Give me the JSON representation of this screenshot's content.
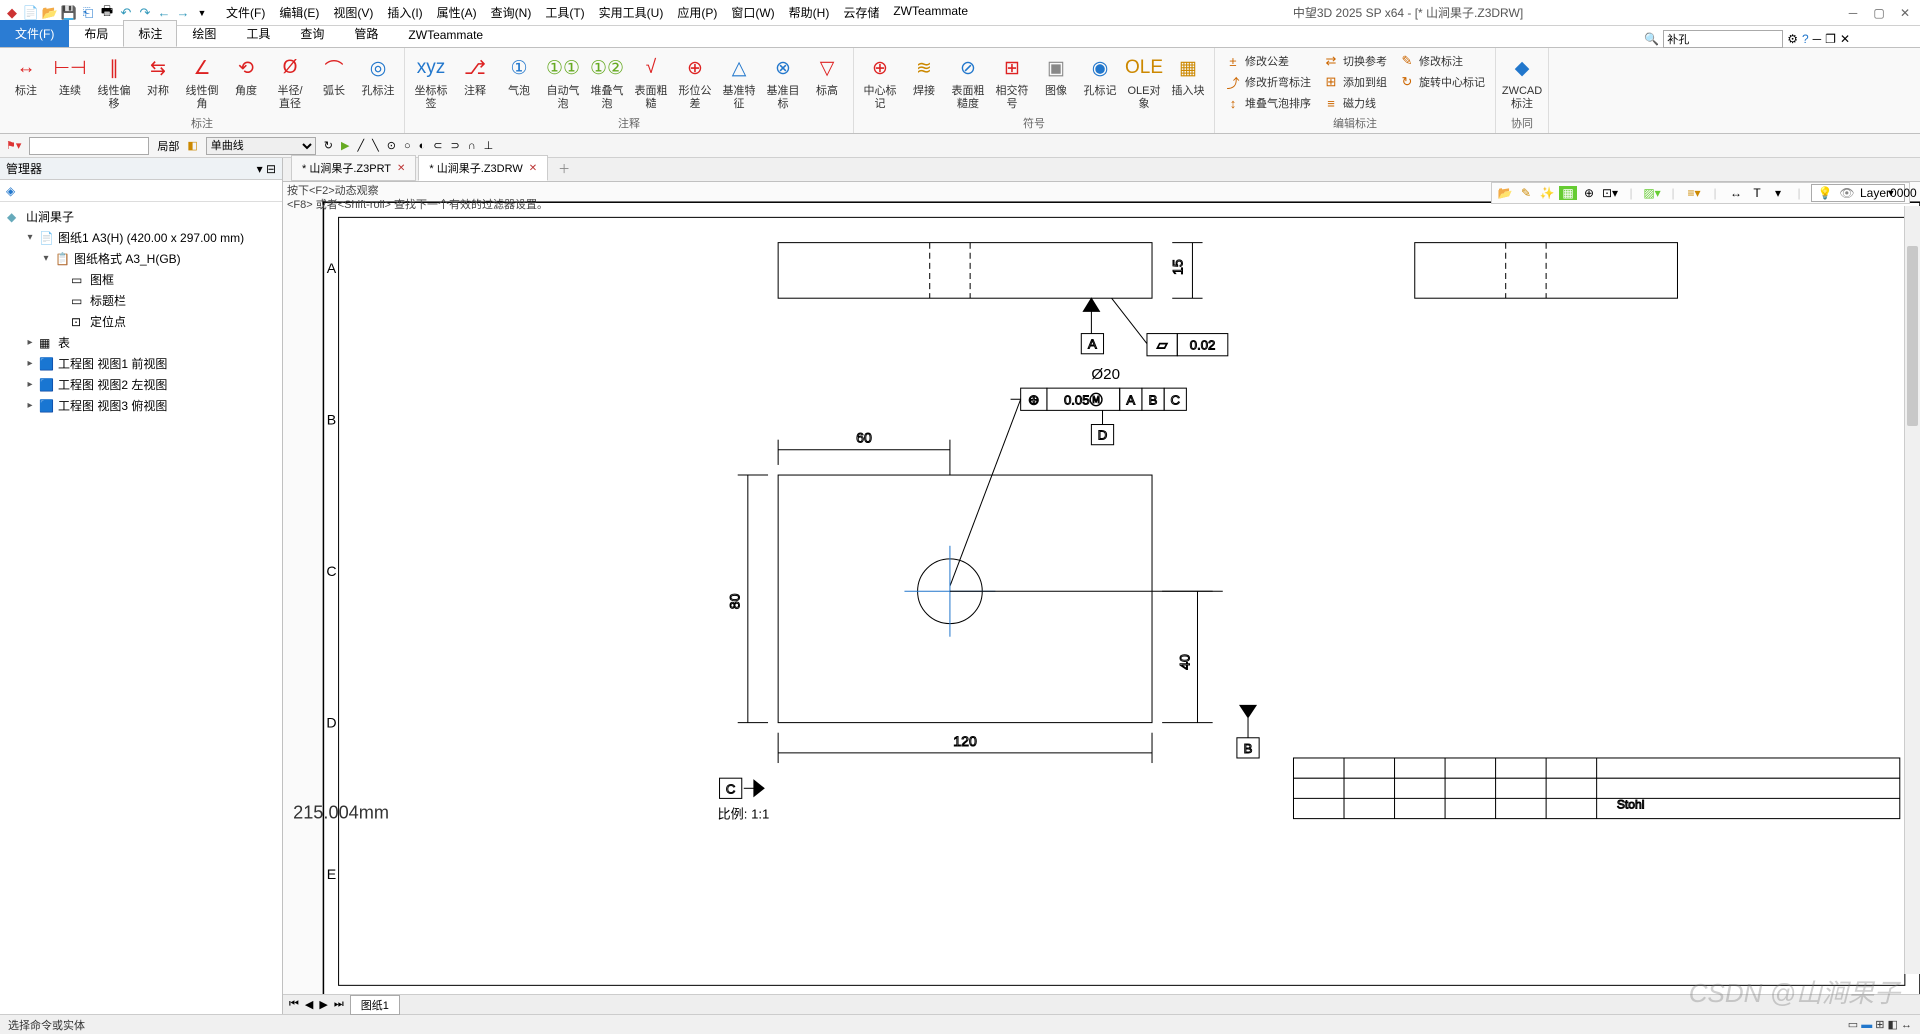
{
  "app": {
    "title": "中望3D 2025 SP x64 - [* 山涧果子.Z3DRW]"
  },
  "qat_icons": [
    "app-logo",
    "new",
    "open",
    "save",
    "saveall",
    "undo",
    "redo",
    "back",
    "fwd"
  ],
  "menus": [
    "文件(F)",
    "编辑(E)",
    "视图(V)",
    "插入(I)",
    "属性(A)",
    "查询(N)",
    "工具(T)",
    "实用工具(U)",
    "应用(P)",
    "窗口(W)",
    "帮助(H)",
    "云存储",
    "ZWTeammate"
  ],
  "tabs": {
    "file": "文件(F)",
    "items": [
      "布局",
      "标注",
      "绘图",
      "工具",
      "查询",
      "管路",
      "ZWTeammate"
    ],
    "active": "标注"
  },
  "ribbon_groups": [
    {
      "label": "标注",
      "btns": [
        {
          "n": "标注",
          "i": "↔",
          "c": "#d22"
        },
        {
          "n": "连续",
          "i": "⊢⊣",
          "c": "#d22"
        },
        {
          "n": "线性偏移",
          "i": "∥",
          "c": "#d22"
        },
        {
          "n": "对称",
          "i": "⇆",
          "c": "#d22"
        },
        {
          "n": "线性倒角",
          "i": "∠",
          "c": "#d22"
        },
        {
          "n": "角度",
          "i": "⟲",
          "c": "#d22"
        },
        {
          "n": "半径/直径",
          "i": "Ø",
          "c": "#d22"
        },
        {
          "n": "弧长",
          "i": "⌒",
          "c": "#d22"
        },
        {
          "n": "孔标注",
          "i": "◎",
          "c": "#27c"
        }
      ]
    },
    {
      "label": "注释",
      "btns": [
        {
          "n": "坐标标签",
          "i": "xyz",
          "c": "#27c"
        },
        {
          "n": "注释",
          "i": "⎇",
          "c": "#d22"
        },
        {
          "n": "气泡",
          "i": "①",
          "c": "#27c"
        },
        {
          "n": "自动气泡",
          "i": "①①",
          "c": "#6a2"
        },
        {
          "n": "堆叠气泡",
          "i": "①②",
          "c": "#6a2"
        },
        {
          "n": "表面粗糙",
          "i": "√",
          "c": "#d22"
        },
        {
          "n": "形位公差",
          "i": "⊕",
          "c": "#d22"
        },
        {
          "n": "基准特征",
          "i": "△",
          "c": "#27c"
        },
        {
          "n": "基准目标",
          "i": "⊗",
          "c": "#27c"
        },
        {
          "n": "标高",
          "i": "▽",
          "c": "#d22"
        }
      ]
    },
    {
      "label": "符号",
      "btns": [
        {
          "n": "中心标记",
          "i": "⊕",
          "c": "#d22"
        },
        {
          "n": "焊接",
          "i": "≋",
          "c": "#c80"
        },
        {
          "n": "表面粗糙度",
          "i": "⊘",
          "c": "#27c"
        },
        {
          "n": "相交符号",
          "i": "⊞",
          "c": "#d22"
        },
        {
          "n": "图像",
          "i": "▣",
          "c": "#888"
        },
        {
          "n": "孔标记",
          "i": "◉",
          "c": "#27c"
        },
        {
          "n": "OLE对象",
          "i": "OLE",
          "c": "#c80"
        },
        {
          "n": "插入块",
          "i": "▦",
          "c": "#c80"
        }
      ]
    },
    {
      "label": "编辑标注",
      "small": true,
      "btns": [
        {
          "n": "修改公差",
          "i": "±"
        },
        {
          "n": "修改折弯标注",
          "i": "⤴"
        },
        {
          "n": "堆叠气泡排序",
          "i": "↕"
        },
        {
          "n": "切换参考",
          "i": "⇄"
        },
        {
          "n": "添加到组",
          "i": "⊞"
        },
        {
          "n": "磁力线",
          "i": "≡"
        },
        {
          "n": "修改标注",
          "i": "✎"
        },
        {
          "n": "旋转中心标记",
          "i": "↻"
        }
      ]
    },
    {
      "label": "协同",
      "btns": [
        {
          "n": "ZWCAD标注",
          "i": "◆",
          "c": "#27c"
        }
      ]
    }
  ],
  "subbar": {
    "scope": "局部",
    "filter": "单曲线"
  },
  "manager": {
    "title": "管理器",
    "root": "山涧果子",
    "tree": [
      {
        "d": 1,
        "exp": "▾",
        "ico": "📄",
        "txt": "图纸1 A3(H) (420.00 x 297.00 mm)"
      },
      {
        "d": 2,
        "exp": "▾",
        "ico": "📋",
        "txt": "图纸格式 A3_H(GB)"
      },
      {
        "d": 3,
        "exp": "",
        "ico": "▭",
        "txt": "图框"
      },
      {
        "d": 3,
        "exp": "",
        "ico": "▭",
        "txt": "标题栏"
      },
      {
        "d": 3,
        "exp": "",
        "ico": "⊡",
        "txt": "定位点"
      },
      {
        "d": 1,
        "exp": "▸",
        "ico": "▦",
        "txt": "表"
      },
      {
        "d": 1,
        "exp": "▸",
        "ico": "🟦",
        "txt": "工程图 视图1 前视图"
      },
      {
        "d": 1,
        "exp": "▸",
        "ico": "🟦",
        "txt": "工程图 视图2 左视图"
      },
      {
        "d": 1,
        "exp": "▸",
        "ico": "🟦",
        "txt": "工程图 视图3 俯视图"
      }
    ]
  },
  "doctabs": [
    {
      "label": "* 山涧果子.Z3PRT",
      "active": false
    },
    {
      "label": "* 山涧果子.Z3DRW",
      "active": true
    }
  ],
  "hint": {
    "l1": "按下<F2>动态观察",
    "l2": "<F8> 或者<Shift-roll> 查找下一个有效的过滤器设置。"
  },
  "layer": "Layer0000",
  "drawing": {
    "border_rows": [
      "A",
      "B",
      "C",
      "D",
      "E"
    ],
    "top_dim": "15",
    "datum_top": "A",
    "gtol_top": "0.02",
    "diam": "Ø20",
    "gtol_mid": "0.05",
    "gtol_abc": [
      "A",
      "B",
      "C"
    ],
    "datum_mid": "D",
    "dim60": "60",
    "dim80": "80",
    "dim40": "40",
    "dim120": "120",
    "datum_left": "C",
    "datum_right": "B",
    "titleblock": "Stohl",
    "coord": "215.004mm",
    "scale_label": "比例:",
    "scale": "1:1"
  },
  "sheetbar": {
    "sheet": "图纸1"
  },
  "status": {
    "prompt": "选择命令或实体"
  },
  "search": {
    "placeholder": "补孔"
  },
  "watermark": "CSDN @山涧果子"
}
